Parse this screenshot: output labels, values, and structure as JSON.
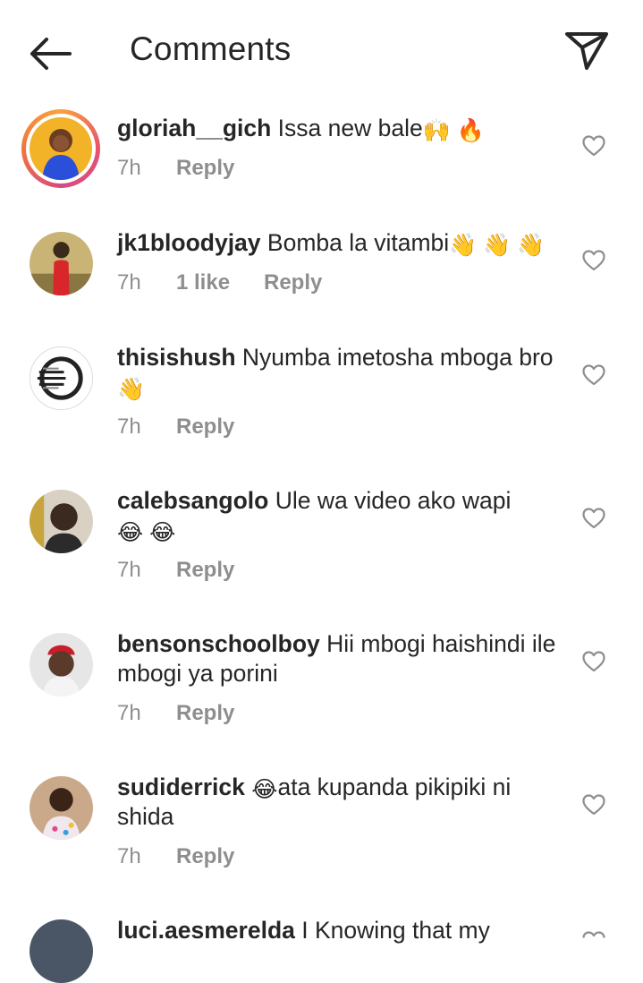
{
  "header": {
    "title": "Comments",
    "back_icon": "arrow-left-icon",
    "share_icon": "paper-plane-icon"
  },
  "colors": {
    "text": "#262626",
    "muted": "#8e8e8e",
    "story_ring": "#e8516f"
  },
  "comments": [
    {
      "username": "gloriah__gich",
      "text": "Issa new bale",
      "emojis": "🙌 🔥",
      "time": "7h",
      "likes": "",
      "reply": "Reply",
      "avatar_icon": "avatar-photo-icon",
      "story_ring": true
    },
    {
      "username": "jk1bloodyjay",
      "text": "Bomba la vitambi",
      "emojis": "👋 👋 👋",
      "time": "7h",
      "likes": "1 like",
      "reply": "Reply",
      "avatar_icon": "avatar-photo-icon"
    },
    {
      "username": "thisishush",
      "text": "Nyumba imetosha mboga bro",
      "emojis": "👋",
      "time": "7h",
      "likes": "",
      "reply": "Reply",
      "avatar_icon": "logo-avatar-icon"
    },
    {
      "username": "calebsangolo",
      "text": "Ule wa video ako wapi",
      "emojis": "😂 😂",
      "time": "7h",
      "likes": "",
      "reply": "Reply",
      "avatar_icon": "avatar-photo-icon"
    },
    {
      "username": "bensonschoolboy",
      "text": "Hii mbogi haishindi ile mbogi ya porini",
      "emojis": "",
      "time": "7h",
      "likes": "",
      "reply": "Reply",
      "avatar_icon": "avatar-photo-icon"
    },
    {
      "username": "sudiderrick",
      "text": "ata kupanda pikipiki ni shida",
      "emojis": "😂",
      "time": "7h",
      "likes": "",
      "reply": "Reply",
      "avatar_icon": "avatar-photo-icon"
    },
    {
      "username": "luci.aesmerelda",
      "text": "I Knowing that my",
      "emojis": "",
      "time": "",
      "likes": "",
      "reply": "",
      "avatar_icon": "avatar-photo-icon"
    }
  ]
}
